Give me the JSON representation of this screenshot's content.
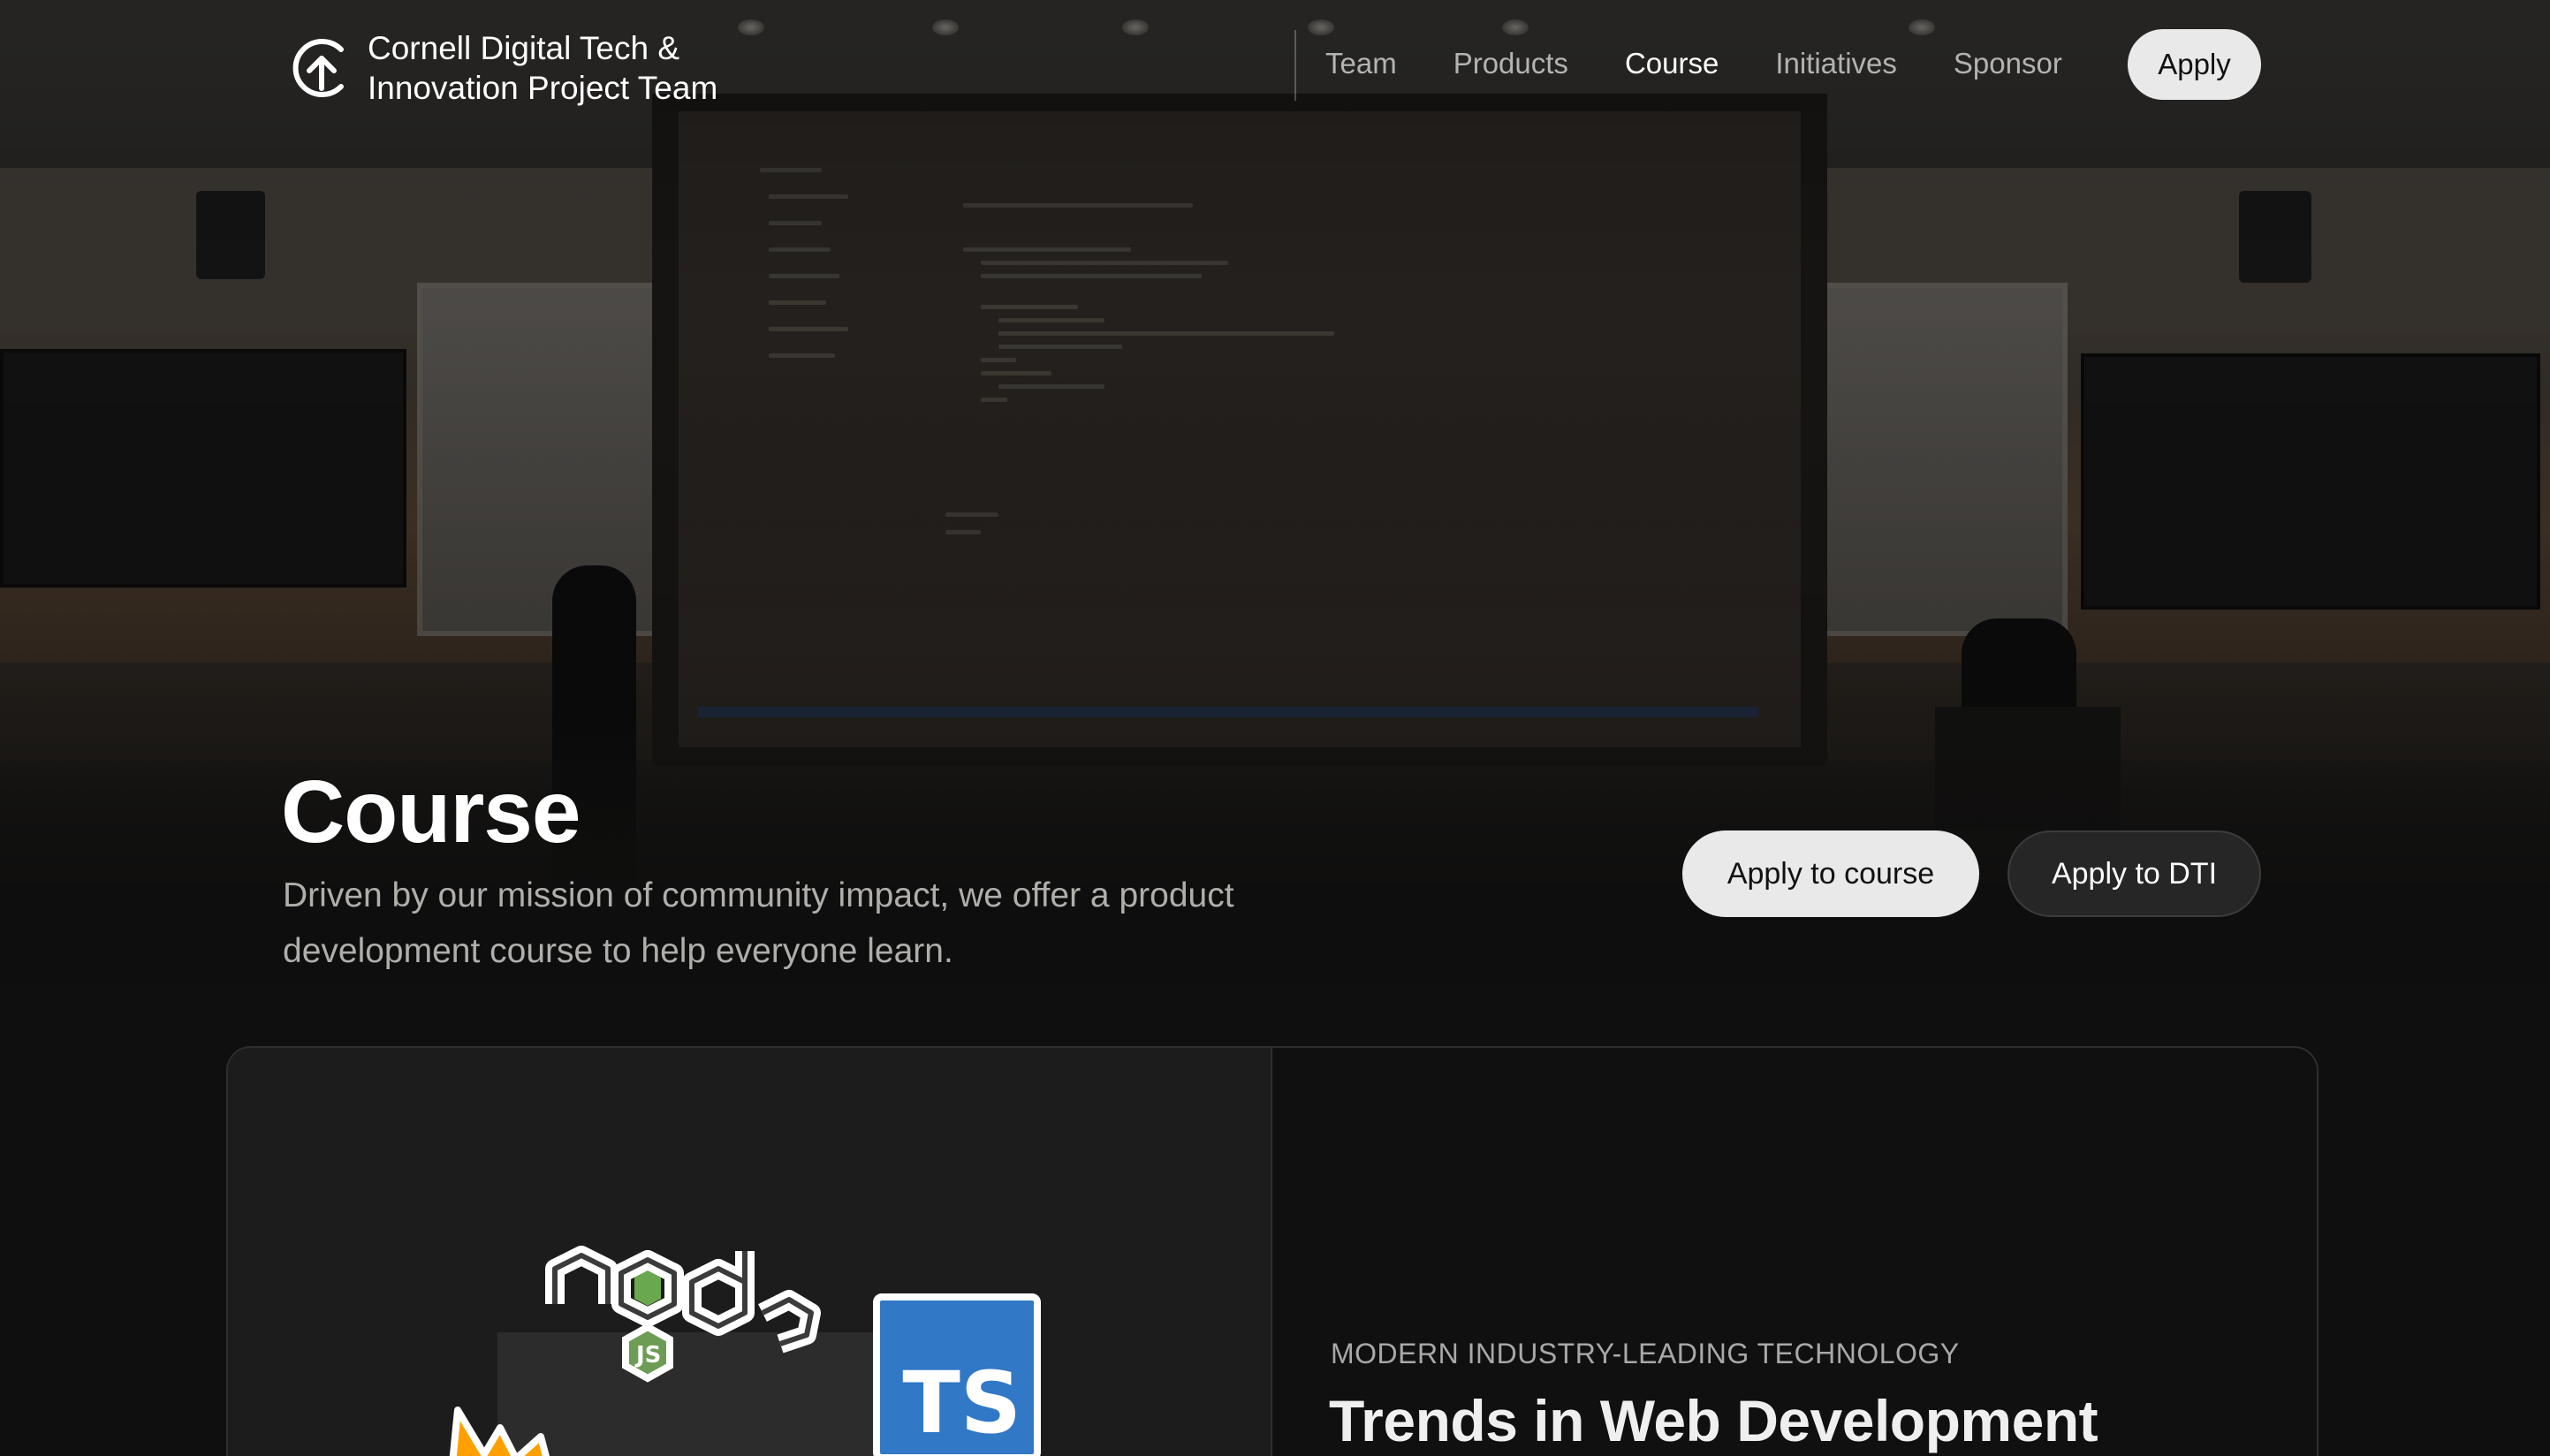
{
  "nav": {
    "logo_line1": "Cornell Digital Tech &",
    "logo_line2": "Innovation Project Team",
    "links": [
      "Team",
      "Products",
      "Course",
      "Initiatives",
      "Sponsor"
    ],
    "active": "Course",
    "apply_label": "Apply"
  },
  "hero": {
    "title": "Course",
    "description": "Driven by our mission of community impact, we offer a product development course to help everyone learn.",
    "apply_course_label": "Apply to course",
    "apply_dti_label": "Apply to DTI"
  },
  "feature": {
    "eyebrow": "MODERN INDUSTRY-LEADING TECHNOLOGY",
    "title": "Trends in Web Development",
    "ts_badge": "TS",
    "logos": [
      "node-js-logo",
      "typescript-logo",
      "firebase-logo"
    ]
  },
  "colors": {
    "background": "#0f0f0f",
    "button_light": "#e9e9e9",
    "nav_inactive": "#b3b3b3",
    "typescript_blue": "#3178c6"
  }
}
